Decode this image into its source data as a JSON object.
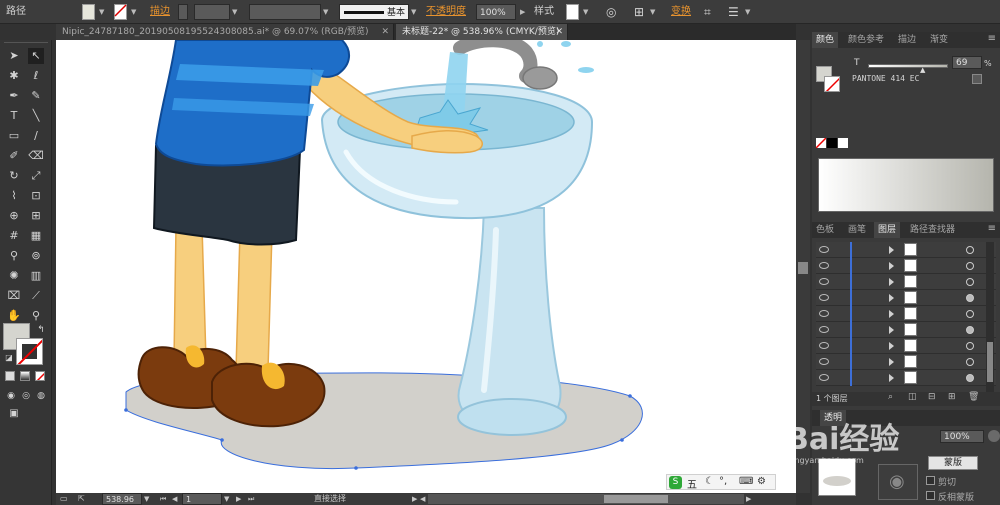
{
  "control_bar": {
    "object_type": "路径",
    "stroke_label": "描边",
    "stroke_profile": "基本",
    "opacity_label": "不透明度",
    "opacity_value": "100%",
    "style_label": "样式",
    "transform_label": "变换"
  },
  "doc_tabs": [
    "Nipic_24787180_20190508195524308085.ai* @ 69.07% (RGB/预览)",
    "未标题-22* @ 538.96% (CMYK/预览)"
  ],
  "color_panel": {
    "tabs": [
      "颜色",
      "颜色参考",
      "描边",
      "渐变"
    ],
    "tint_label": "T",
    "tint_value": "69",
    "percent": "%",
    "swatch_name": "PANTONE 414 EC"
  },
  "layers_panel": {
    "tabs": [
      "色板",
      "画笔",
      "图层",
      "路径查找器"
    ],
    "rows": [
      {
        "target_filled": false
      },
      {
        "target_filled": false
      },
      {
        "target_filled": false
      },
      {
        "target_filled": true
      },
      {
        "target_filled": false
      },
      {
        "target_filled": true
      },
      {
        "target_filled": false
      },
      {
        "target_filled": false
      },
      {
        "target_filled": true
      }
    ],
    "count_label": "1 个图层"
  },
  "transparency_panel": {
    "tab": "透明",
    "opacity_value": "100%",
    "mask_button": "蒙版",
    "clip_label": "剪切",
    "invert_label": "反相蒙版"
  },
  "status_bar": {
    "zoom": "538.96",
    "page": "1",
    "tool_status": "直接选择"
  },
  "ime": {
    "label": "五"
  },
  "watermark": {
    "text": "Bai经验",
    "url": "jingyan.baidu.com"
  },
  "colors": {
    "shirt": "#1e6ec8",
    "skin": "#f7cf7e",
    "shorts": "#2a3540",
    "shoe": "#7b3b0e",
    "sink": "#c5e2f0",
    "shadow": "#d2d0cb",
    "selection": "#3a6edc"
  }
}
